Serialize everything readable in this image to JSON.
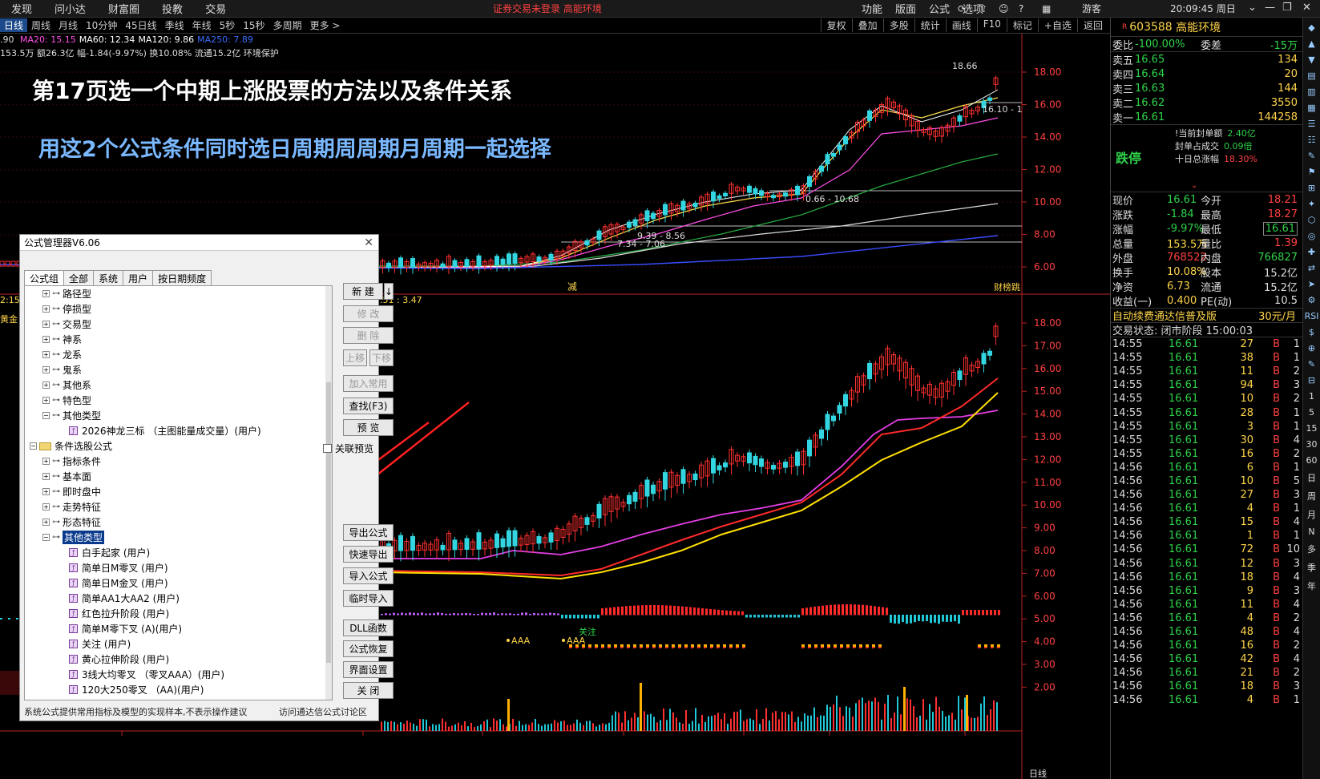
{
  "topbar": {
    "menus": [
      "发现",
      "问小达",
      "财富圈",
      "投教",
      "交易"
    ],
    "warning": "证券交易未登录   高能环境",
    "right_menus": [
      "功能",
      "版面",
      "公式",
      "选项"
    ],
    "user": "游客",
    "clock": "20:09:45 周日"
  },
  "periods": {
    "items": [
      "日线",
      "周线",
      "月线",
      "10分钟",
      "45日线",
      "季线",
      "年线",
      "5秒",
      "15秒",
      "多周期",
      "更多 >"
    ],
    "tools": [
      "复权",
      "叠加",
      "多股",
      "统计",
      "画线",
      "F10",
      "标记",
      "+自选",
      "返回"
    ]
  },
  "indicators": {
    "line1": [
      {
        "text": "MA20: 15.15",
        "color": "#ff4fe6"
      },
      {
        "text": "MA60: 12.34",
        "color": "#ffffff"
      },
      {
        "text": "MA120: 9.86",
        "color": "#ffffff"
      },
      {
        "text": "MA250: 7.89",
        "color": "#3a6cff"
      }
    ],
    "line1_prefix": ".90",
    "line2": "153.5万 额26.3亿 幅-1.84(-9.97%) 换10.08% 流通15.2亿 环境保护"
  },
  "headlines": {
    "title": "第17页选一个中期上涨股票的方法以及条件关系",
    "subtitle": "用这2个公式条件同时选日周期周周期月周期一起选择"
  },
  "chart": {
    "upper_axis": [
      "18.00",
      "16.00",
      "14.00",
      "12.00",
      "10.00",
      "8.00",
      "6.00"
    ],
    "lower_axis": [
      "18.00",
      "17.00",
      "16.00",
      "15.00",
      "14.00",
      "13.00",
      "12.00",
      "11.00",
      "10.00",
      "9.00",
      "8.00",
      "7.00",
      "6.00",
      "5.00",
      "4.00",
      "3.00",
      "2.00"
    ],
    "annotations": {
      "high": "18.66",
      "range1": "16.10 - 1",
      "range2": "0.66 - 10.68",
      "range3": "9.39 - 8.56",
      "range4": "7.34 - 7.06",
      "jian": "减",
      "caiban": "财榜跳",
      "lower_value": ".51 : 3.47",
      "left_value": "2:15",
      "left_gold": "黄金",
      "aaa1": "AAA",
      "aaa2": "AAA",
      "guanzhu": "关注",
      "bottom_date_label": "日线"
    }
  },
  "quote": {
    "code": "603588",
    "name": "高能环境",
    "weibi_label": "委比",
    "weibi": "-100.00%",
    "weicha_label": "委差",
    "weicha": "-15万",
    "asks": [
      {
        "label": "卖五",
        "price": "16.65",
        "vol": "134"
      },
      {
        "label": "卖四",
        "price": "16.64",
        "vol": "20"
      },
      {
        "label": "卖三",
        "price": "16.63",
        "vol": "144"
      },
      {
        "label": "卖二",
        "price": "16.62",
        "vol": "3550"
      },
      {
        "label": "卖一",
        "price": "16.61",
        "vol": "144258"
      }
    ],
    "limit_title": "跌停",
    "limit_info": [
      {
        "label": "!当前封单额",
        "value": "2.40亿"
      },
      {
        "label": "封单占成交",
        "value": "0.09倍"
      },
      {
        "label": "十日总涨幅",
        "value": "18.30%"
      }
    ],
    "stats": [
      {
        "l1": "现价",
        "v1": "16.61",
        "l2": "今开",
        "v2": "18.21"
      },
      {
        "l1": "涨跌",
        "v1": "-1.84",
        "l2": "最高",
        "v2": "18.27"
      },
      {
        "l1": "涨幅",
        "v1": "-9.97%",
        "l2": "最低",
        "v2": "16.61"
      },
      {
        "l1": "总量",
        "v1": "153.5万",
        "l2": "量比",
        "v2": "1.39"
      },
      {
        "l1": "外盘",
        "v1": "768522",
        "l2": "内盘",
        "v2": "766827"
      },
      {
        "l1": "换手",
        "v1": "10.08%",
        "l2": "股本",
        "v2": "15.2亿"
      },
      {
        "l1": "净资",
        "v1": "6.73",
        "l2": "流通",
        "v2": "15.2亿"
      },
      {
        "l1": "收益(一)",
        "v1": "0.400",
        "l2": "PE(动)",
        "v2": "10.5"
      }
    ],
    "ad": "自动续费通达信普及版",
    "ad_price": "30元/月",
    "trade_status": "交易状态: 闭市阶段 15:00:03",
    "ticks": [
      {
        "t": "14:55",
        "p": "16.61",
        "v": "27",
        "s": "B",
        "n": "1"
      },
      {
        "t": "14:55",
        "p": "16.61",
        "v": "38",
        "s": "B",
        "n": "1"
      },
      {
        "t": "14:55",
        "p": "16.61",
        "v": "11",
        "s": "B",
        "n": "2"
      },
      {
        "t": "14:55",
        "p": "16.61",
        "v": "94",
        "s": "B",
        "n": "3"
      },
      {
        "t": "14:55",
        "p": "16.61",
        "v": "10",
        "s": "B",
        "n": "2"
      },
      {
        "t": "14:55",
        "p": "16.61",
        "v": "28",
        "s": "B",
        "n": "1"
      },
      {
        "t": "14:55",
        "p": "16.61",
        "v": "3",
        "s": "B",
        "n": "1"
      },
      {
        "t": "14:55",
        "p": "16.61",
        "v": "30",
        "s": "B",
        "n": "4"
      },
      {
        "t": "14:55",
        "p": "16.61",
        "v": "16",
        "s": "B",
        "n": "2"
      },
      {
        "t": "14:56",
        "p": "16.61",
        "v": "6",
        "s": "B",
        "n": "1"
      },
      {
        "t": "14:56",
        "p": "16.61",
        "v": "10",
        "s": "B",
        "n": "5"
      },
      {
        "t": "14:56",
        "p": "16.61",
        "v": "27",
        "s": "B",
        "n": "3"
      },
      {
        "t": "14:56",
        "p": "16.61",
        "v": "4",
        "s": "B",
        "n": "1"
      },
      {
        "t": "14:56",
        "p": "16.61",
        "v": "15",
        "s": "B",
        "n": "4"
      },
      {
        "t": "14:56",
        "p": "16.61",
        "v": "1",
        "s": "B",
        "n": "1"
      },
      {
        "t": "14:56",
        "p": "16.61",
        "v": "72",
        "s": "B",
        "n": "10"
      },
      {
        "t": "14:56",
        "p": "16.61",
        "v": "12",
        "s": "B",
        "n": "3"
      },
      {
        "t": "14:56",
        "p": "16.61",
        "v": "18",
        "s": "B",
        "n": "4"
      },
      {
        "t": "14:56",
        "p": "16.61",
        "v": "9",
        "s": "B",
        "n": "3"
      },
      {
        "t": "14:56",
        "p": "16.61",
        "v": "11",
        "s": "B",
        "n": "4"
      },
      {
        "t": "14:56",
        "p": "16.61",
        "v": "4",
        "s": "B",
        "n": "2"
      },
      {
        "t": "14:56",
        "p": "16.61",
        "v": "48",
        "s": "B",
        "n": "4"
      },
      {
        "t": "14:56",
        "p": "16.61",
        "v": "16",
        "s": "B",
        "n": "2"
      },
      {
        "t": "14:56",
        "p": "16.61",
        "v": "42",
        "s": "B",
        "n": "4"
      },
      {
        "t": "14:56",
        "p": "16.61",
        "v": "21",
        "s": "B",
        "n": "2"
      },
      {
        "t": "14:56",
        "p": "16.61",
        "v": "18",
        "s": "B",
        "n": "3"
      },
      {
        "t": "14:56",
        "p": "16.61",
        "v": "4",
        "s": "B",
        "n": "1"
      }
    ]
  },
  "sidebar": [
    "RSI",
    "1",
    "5",
    "15",
    "30",
    "60",
    "日",
    "周",
    "月",
    "N",
    "多",
    "季",
    "年"
  ],
  "dialog": {
    "title": "公式管理器V6.06",
    "tabs": [
      "公式组",
      "全部",
      "系统",
      "用户",
      "按日期频度"
    ],
    "tree": [
      {
        "level": 1,
        "type": "key",
        "label": "路径型"
      },
      {
        "level": 1,
        "type": "key",
        "label": "停损型"
      },
      {
        "level": 1,
        "type": "key",
        "label": "交易型"
      },
      {
        "level": 1,
        "type": "key",
        "label": "神系"
      },
      {
        "level": 1,
        "type": "key",
        "label": "龙系"
      },
      {
        "level": 1,
        "type": "key",
        "label": "鬼系"
      },
      {
        "level": 1,
        "type": "key",
        "label": "其他系"
      },
      {
        "level": 1,
        "type": "key",
        "label": "特色型"
      },
      {
        "level": 1,
        "type": "key-open",
        "label": "其他类型"
      },
      {
        "level": 2,
        "type": "formula",
        "label": "2026神龙三标 （主图能量成交量）(用户)"
      },
      {
        "level": 0,
        "type": "folder",
        "label": "条件选股公式"
      },
      {
        "level": 1,
        "type": "key",
        "label": "指标条件"
      },
      {
        "level": 1,
        "type": "key",
        "label": "基本面"
      },
      {
        "level": 1,
        "type": "key",
        "label": "即时盘中"
      },
      {
        "level": 1,
        "type": "key",
        "label": "走势特征"
      },
      {
        "level": 1,
        "type": "key",
        "label": "形态特征"
      },
      {
        "level": 1,
        "type": "key-open-sel",
        "label": "其他类型"
      },
      {
        "level": 2,
        "type": "formula",
        "label": "白手起家 (用户)"
      },
      {
        "level": 2,
        "type": "formula",
        "label": "简单日M零叉 (用户)"
      },
      {
        "level": 2,
        "type": "formula",
        "label": "简单日M金叉 (用户)"
      },
      {
        "level": 2,
        "type": "formula",
        "label": "简单AA1大AA2 (用户)"
      },
      {
        "level": 2,
        "type": "formula",
        "label": "红色拉升阶段 (用户)"
      },
      {
        "level": 2,
        "type": "formula",
        "label": "简单M零下叉 (A)(用户)"
      },
      {
        "level": 2,
        "type": "formula",
        "label": "关注 (用户)"
      },
      {
        "level": 2,
        "type": "formula",
        "label": "黄心拉伸阶段 (用户)"
      },
      {
        "level": 2,
        "type": "formula",
        "label": "3线大均零叉 （零叉AAA）(用户)"
      },
      {
        "level": 2,
        "type": "formula",
        "label": "120大250零叉 （AA)(用户)"
      }
    ],
    "buttons": {
      "new": "新 建",
      "modify": "修 改",
      "delete": "删 除",
      "up": "上移",
      "down": "下移",
      "add_common": "加入常用",
      "find": "查找(F3)",
      "preview": "预 览",
      "export": "导出公式",
      "quick_export": "快速导出",
      "import": "导入公式",
      "temp_import": "临时导入",
      "dll": "DLL函数",
      "restore": "公式恢复",
      "ui": "界面设置",
      "close": "关 闭"
    },
    "checkbox": "关联预览",
    "footer_left": "系统公式提供常用指标及模型的实现样本,不表示操作建议",
    "footer_right": "访问通达信公式讨论区"
  }
}
